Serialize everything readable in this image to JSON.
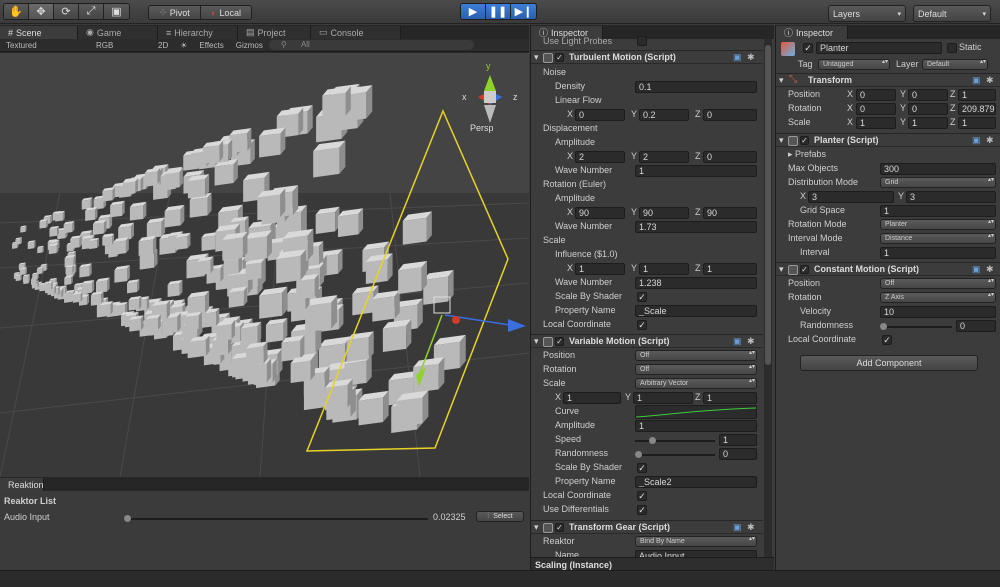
{
  "toolbar": {
    "pivot": "Pivot",
    "local": "Local",
    "layers": "Layers",
    "layout": "Default"
  },
  "scene_tabs": {
    "scene": "Scene",
    "game": "Game",
    "hierarchy": "Hierarchy",
    "project": "Project",
    "console": "Console"
  },
  "scene_bar": {
    "shading": "Textured",
    "render": "RGB",
    "mode2d": "2D",
    "effects": "Effects",
    "gizmos": "Gizmos",
    "search": "All",
    "persp": "Persp"
  },
  "gizmo_axes": {
    "y": "y",
    "x": "x",
    "z": "z"
  },
  "reaktion": {
    "tab": "Reaktion",
    "title": "Reaktor List",
    "input_label": "Audio Input",
    "value": "0.02325",
    "select": "Select"
  },
  "inspector_left": {
    "tab": "Inspector",
    "top_clip": "Use Light Probes",
    "turbulent": {
      "title": "Turbulent Motion (Script)",
      "noise": "Noise",
      "density_label": "Density",
      "density": "0.1",
      "linear_flow": "Linear Flow",
      "lf": {
        "x": "0",
        "y": "0.2",
        "z": "0"
      },
      "displacement": "Displacement",
      "amplitude": "Amplitude",
      "disp_amp": {
        "x": "2",
        "y": "2",
        "z": "0"
      },
      "wave_number": "Wave Number",
      "disp_wave": "1",
      "rotation": "Rotation (Euler)",
      "rot_amp": {
        "x": "90",
        "y": "90",
        "z": "90"
      },
      "rot_wave": "1.73",
      "scale": "Scale",
      "influence": "Influence ($1.0)",
      "scale_inf": {
        "x": "1",
        "y": "1",
        "z": "1"
      },
      "scale_wave": "1.238",
      "scale_by_shader": "Scale By Shader",
      "property_name": "Property Name",
      "prop": "_Scale",
      "local_coord": "Local Coordinate"
    },
    "variable": {
      "title": "Variable Motion (Script)",
      "position": "Position",
      "pos_val": "Off",
      "rotation": "Rotation",
      "rot_val": "Off",
      "scale": "Scale",
      "scale_val": "Arbitrary Vector",
      "sv": {
        "x": "1",
        "y": "1",
        "z": "1"
      },
      "curve": "Curve",
      "amplitude": "Amplitude",
      "amp": "1",
      "speed": "Speed",
      "speed_val": "1",
      "randomness": "Randomness",
      "rand_val": "0",
      "scale_by_shader": "Scale By Shader",
      "property_name": "Property Name",
      "prop": "_Scale2",
      "local_coord": "Local Coordinate",
      "use_diff": "Use Differentials"
    },
    "gear": {
      "title": "Transform Gear (Script)",
      "reaktor": "Reaktor",
      "reaktor_val": "Bind By Name",
      "name": "Name",
      "name_val": "Audio Input"
    },
    "footer": "Scaling (Instance)"
  },
  "inspector_right": {
    "tab": "Inspector",
    "object": "Planter",
    "static": "Static",
    "tag_label": "Tag",
    "tag": "Untagged",
    "layer_label": "Layer",
    "layer": "Default",
    "transform": {
      "title": "Transform",
      "position": "Position",
      "pos": {
        "x": "0",
        "y": "0",
        "z": "1"
      },
      "rotation": "Rotation",
      "rot": {
        "x": "0",
        "y": "0",
        "z": "209.879"
      },
      "scale": "Scale",
      "scl": {
        "x": "1",
        "y": "1",
        "z": "1"
      }
    },
    "planter": {
      "title": "Planter (Script)",
      "prefabs": "Prefabs",
      "max_objects": "Max Objects",
      "max_val": "300",
      "dist_mode": "Distribution Mode",
      "dist_val": "Grid",
      "grid": {
        "x": "3",
        "y": "3"
      },
      "grid_space": "Grid Space",
      "gs_val": "1",
      "rot_mode": "Rotation Mode",
      "rot_mode_val": "Planter",
      "int_mode": "Interval Mode",
      "int_mode_val": "Distance",
      "interval": "Interval",
      "int_val": "1"
    },
    "constant": {
      "title": "Constant Motion (Script)",
      "position": "Position",
      "pos_val": "Off",
      "rotation": "Rotation",
      "rot_val": "Z Axis",
      "velocity": "Velocity",
      "vel_val": "10",
      "randomness": "Randomness",
      "rand_val": "0",
      "local_coord": "Local Coordinate"
    },
    "add_component": "Add Component"
  },
  "axis_labels": {
    "x": "X",
    "y": "Y",
    "z": "Z"
  },
  "colors": {
    "sky": "#414141",
    "ground": "#363636",
    "selection": "#e8d225",
    "x_axis": "#d23b2b",
    "y_axis": "#8fd22a",
    "z_axis": "#3a6fe0",
    "play": "#2f6fcf"
  }
}
